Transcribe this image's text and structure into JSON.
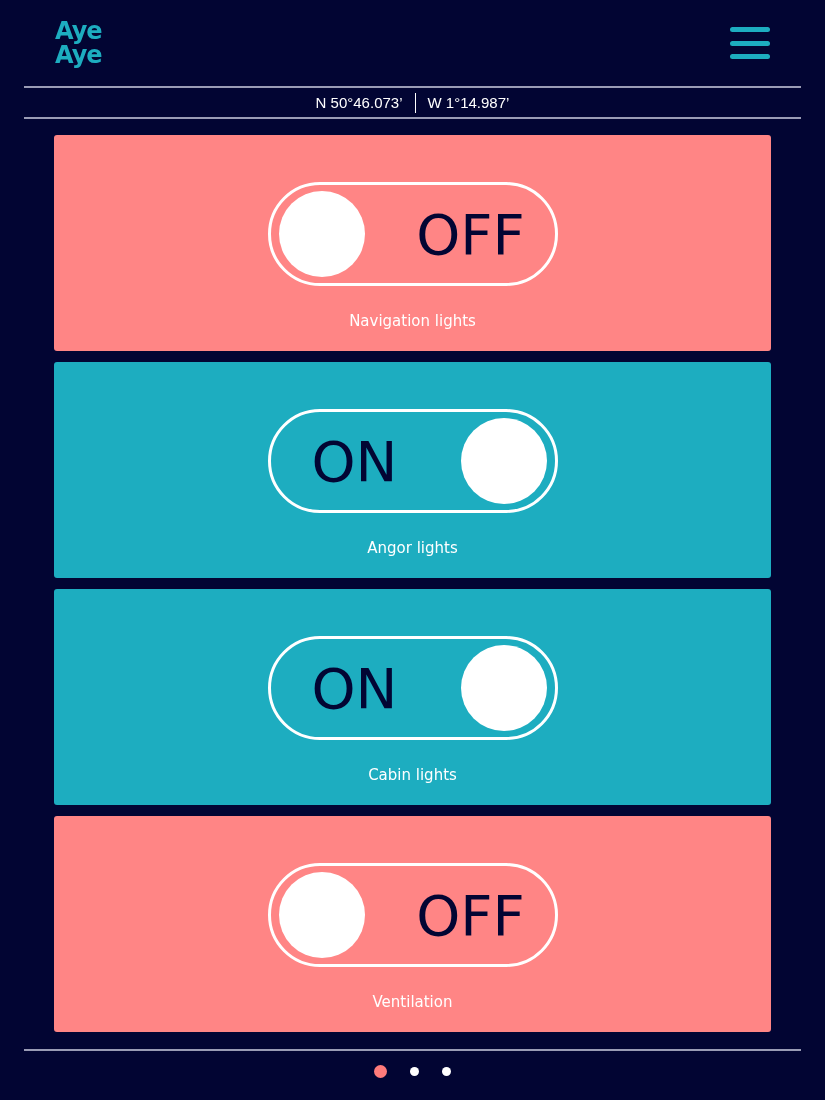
{
  "logo": "Aye Aye",
  "coordinates": [
    "N 50°46.073’",
    "W 1°14.987’"
  ],
  "switches": [
    {
      "label": "Navigation lights",
      "on": false,
      "state_text": "OFF"
    },
    {
      "label": "Angor lights",
      "on": true,
      "state_text": "ON"
    },
    {
      "label": "Cabin lights",
      "on": true,
      "state_text": "ON"
    },
    {
      "label": "Ventilation",
      "on": false,
      "state_text": "OFF"
    }
  ],
  "pages": [
    {
      "selected": true
    },
    {
      "selected": false
    },
    {
      "selected": false
    }
  ]
}
